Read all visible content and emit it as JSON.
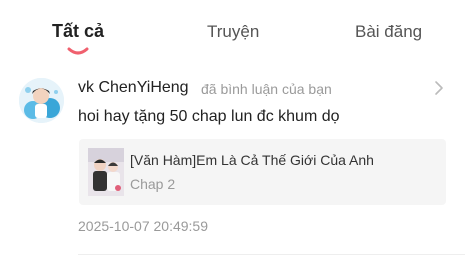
{
  "tabs": {
    "all": "Tất cả",
    "stories": "Truyện",
    "posts": "Bài đăng"
  },
  "accent_color": "#f0606e",
  "notification": {
    "username": "vk ChenYiHeng",
    "action": "đã bình luận của bạn",
    "comment": "hoi hay tặng 50 chap lun đc khum dọ",
    "story_title": "[Văn Hàm]Em Là Cả Thế Giới Của Anh",
    "chapter": "Chap 2",
    "timestamp": "2025-10-07 20:49:59",
    "chevron_icon": "chevron-right-icon"
  }
}
